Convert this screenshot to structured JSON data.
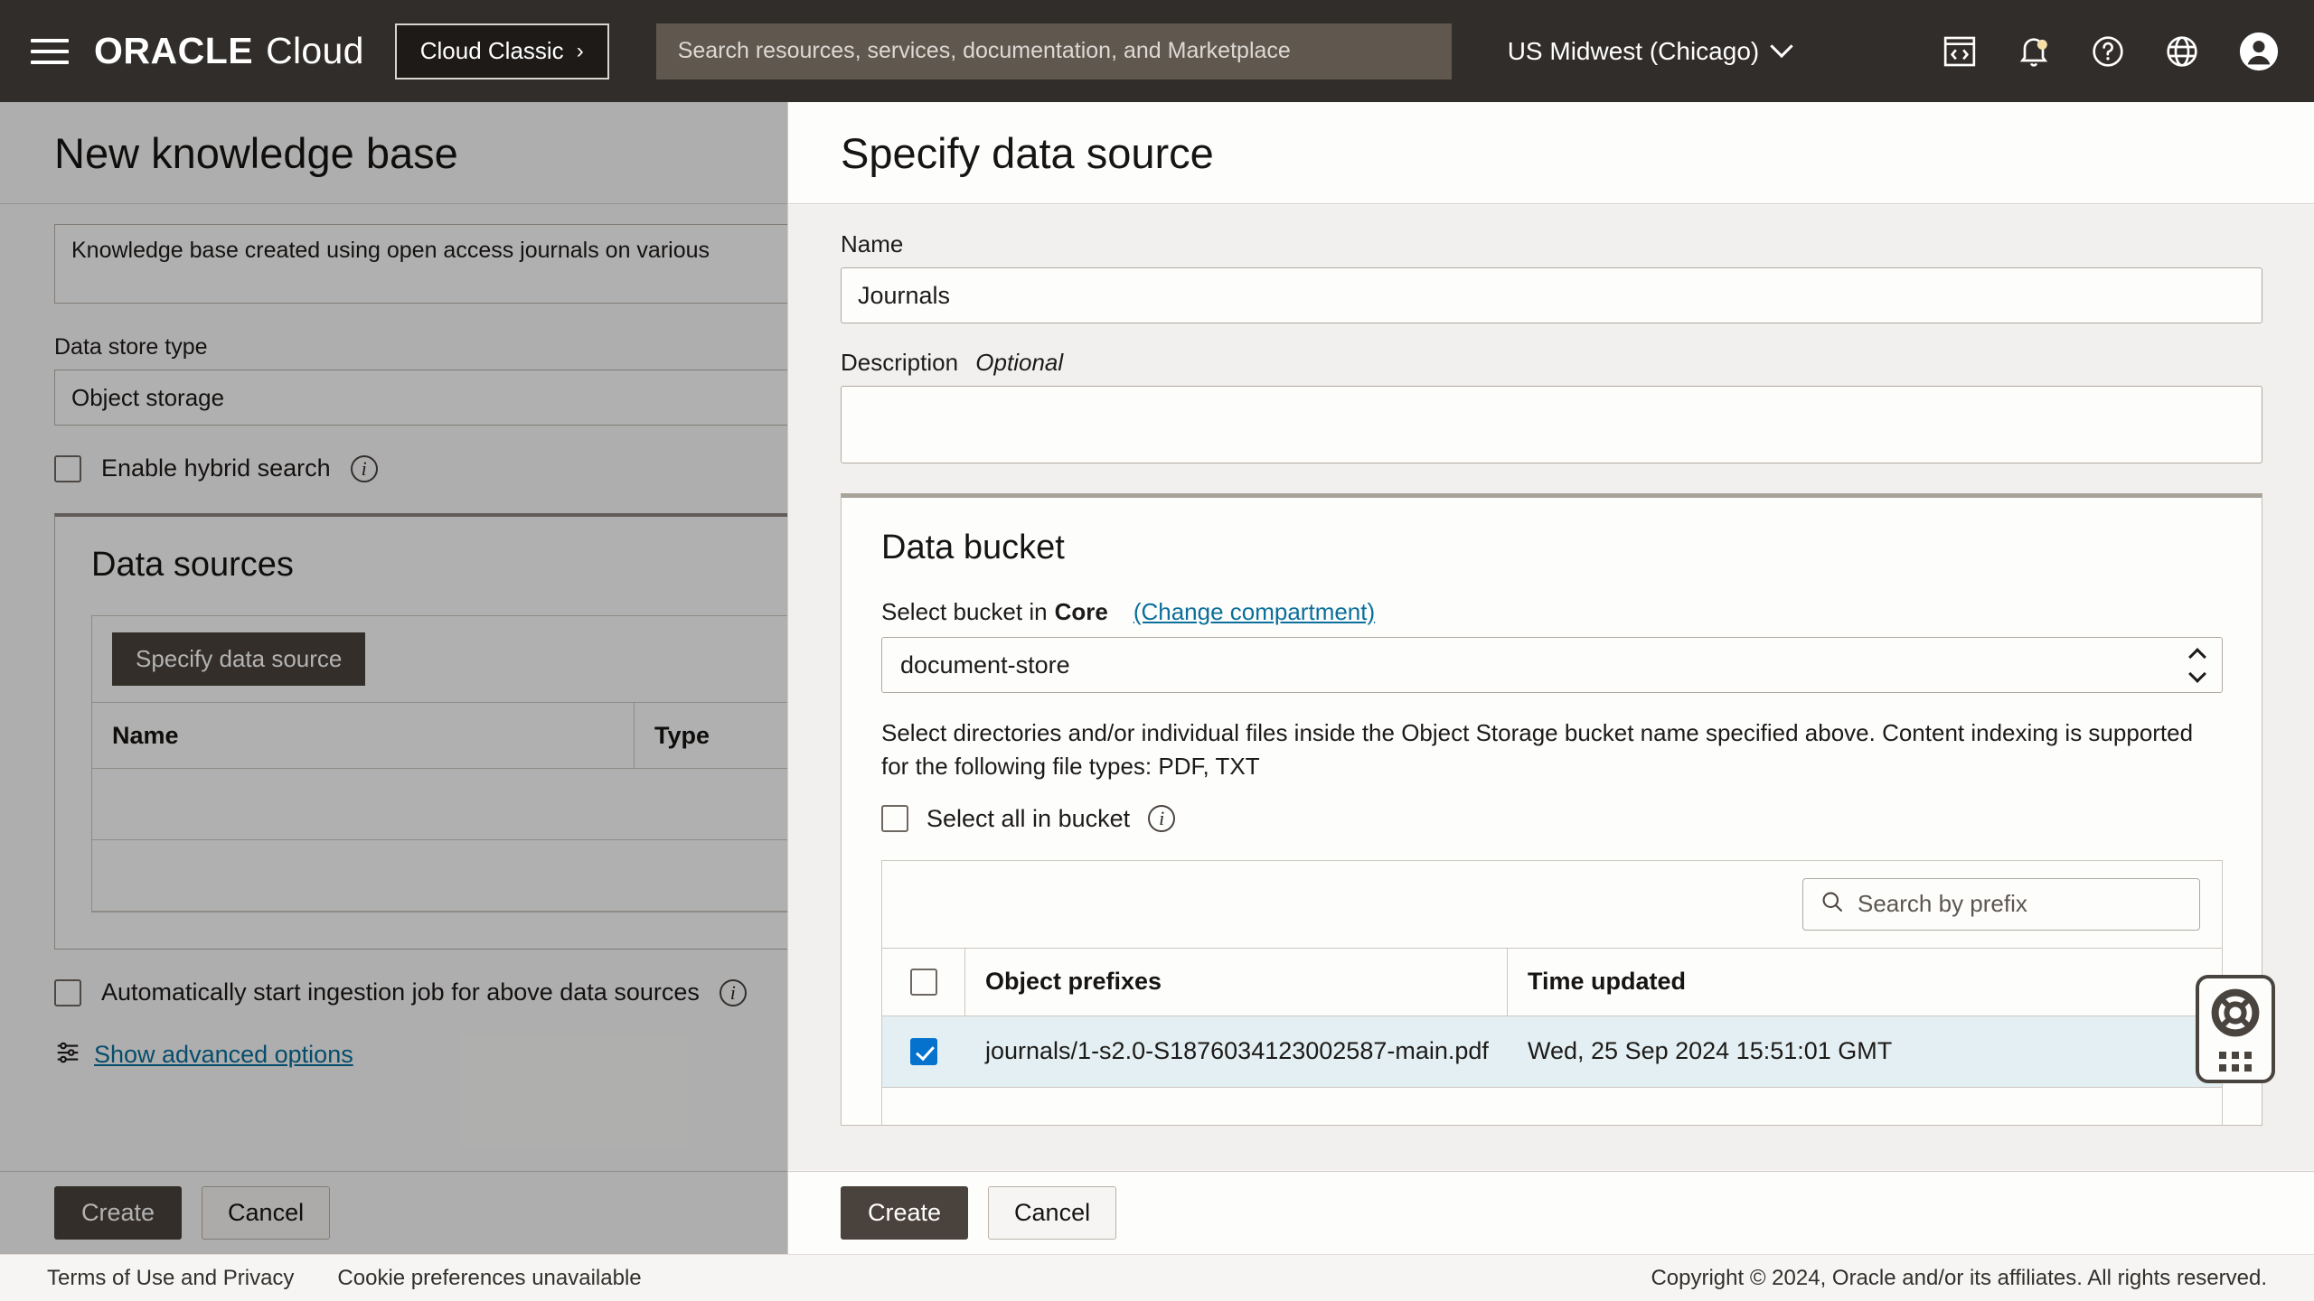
{
  "topnav": {
    "menu_icon": "hamburger-menu-icon",
    "brand_oracle": "ORACLE",
    "brand_cloud": "Cloud",
    "cloud_classic_label": "Cloud Classic",
    "cloud_classic_chevron": "›",
    "search_placeholder": "Search resources, services, documentation, and Marketplace",
    "search_value": "",
    "region": "US Midwest (Chicago)",
    "icons": [
      "developer-console-icon",
      "notifications-bell-icon",
      "help-question-icon",
      "language-globe-icon",
      "user-avatar-icon"
    ],
    "notification_dot_color": "#f5dfa8"
  },
  "knowledge_base": {
    "title": "New knowledge base",
    "description_value": "Knowledge base created using open access journals on various",
    "data_store_type_label": "Data store type",
    "data_store_type_value": "Object storage",
    "hybrid_search_label": "Enable hybrid search",
    "hybrid_search_checked": false,
    "data_sources": {
      "title": "Data sources",
      "specify_button": "Specify data source",
      "columns": [
        "Name",
        "Type"
      ],
      "rows": []
    },
    "auto_ingest_label": "Automatically start ingestion job for above data sources",
    "auto_ingest_checked": false,
    "advanced_options_label": "Show advanced options",
    "advanced_options_icon": "sliders-settings-icon",
    "create_label": "Create",
    "cancel_label": "Cancel"
  },
  "panel": {
    "title": "Specify data source",
    "name_label": "Name",
    "name_value": "Journals",
    "description_label": "Description",
    "description_optional": "Optional",
    "description_value": "",
    "bucket": {
      "title": "Data bucket",
      "select_prefix": "Select bucket in",
      "compartment": "Core",
      "change_compartment_link": "(Change compartment)",
      "selected_bucket": "document-store",
      "stepper_icon": "up-down-chevron-icon",
      "help_text": "Select directories and/or individual files inside the Object Storage bucket name specified above. Content indexing is supported for the following file types: PDF, TXT",
      "select_all_label": "Select all in bucket",
      "select_all_checked": false,
      "search_placeholder": "Search by prefix",
      "search_value": "",
      "search_icon": "search-magnifier-icon",
      "header_checkbox_checked": false,
      "columns": [
        "Object prefixes",
        "Time updated"
      ],
      "rows": [
        {
          "checked": true,
          "prefix": "journals/1-s2.0-S1876034123002587-main.pdf",
          "time_updated": "Wed, 25 Sep 2024 15:51:01 GMT"
        }
      ]
    },
    "create_label": "Create",
    "cancel_label": "Cancel"
  },
  "help_widget": {
    "icon": "lifebuoy-support-icon",
    "drag_handle": "drag-dots-icon"
  },
  "footer": {
    "terms": "Terms of Use and Privacy",
    "cookies": "Cookie preferences unavailable",
    "copyright": "Copyright © 2024, Oracle and/or its affiliates. All rights reserved."
  },
  "colors": {
    "nav_bg": "#312d2a",
    "accent_link": "#0a6f9b",
    "selected_row": "#e3eff2",
    "checkbox_checked": "#0572ce",
    "primary_button": "#4a423c"
  }
}
